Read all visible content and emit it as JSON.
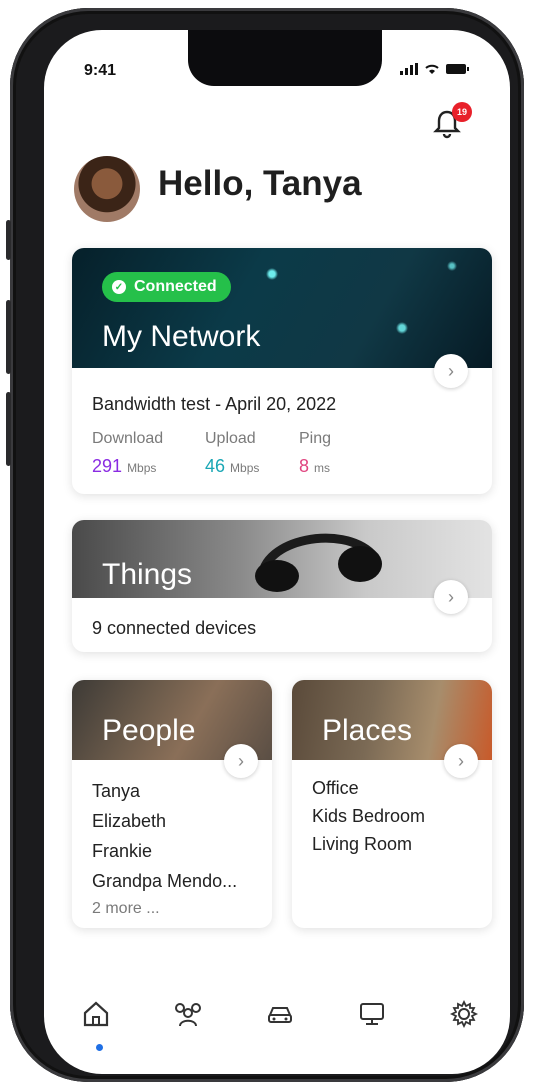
{
  "status_bar": {
    "time": "9:41"
  },
  "notifications": {
    "badge_count": "19"
  },
  "greeting": "Hello, Tanya",
  "network_card": {
    "status": "Connected",
    "title": "My Network",
    "test_label": "Bandwidth test - April 20, 2022",
    "metrics": [
      {
        "label": "Download",
        "value": "291",
        "unit": "Mbps",
        "color": "#8a2be2"
      },
      {
        "label": "Upload",
        "value": "46",
        "unit": "Mbps",
        "color": "#1aa7b5"
      },
      {
        "label": "Ping",
        "value": "8",
        "unit": "ms",
        "color": "#e0447f"
      }
    ]
  },
  "things_card": {
    "title": "Things",
    "subtitle": "9 connected devices"
  },
  "people_card": {
    "title": "People",
    "items": [
      "Tanya",
      "Elizabeth",
      "Frankie",
      "Grandpa Mendo..."
    ],
    "more": "2 more ..."
  },
  "places_card": {
    "title": "Places",
    "items": [
      "Office",
      "Kids Bedroom",
      "Living Room"
    ]
  },
  "bottom_nav": [
    "home-icon",
    "people-icon",
    "car-icon",
    "monitor-icon",
    "settings-icon"
  ],
  "colors": {
    "connected": "#25c04a",
    "badge": "#e8202a",
    "active_nav": "#1f6fe5"
  }
}
